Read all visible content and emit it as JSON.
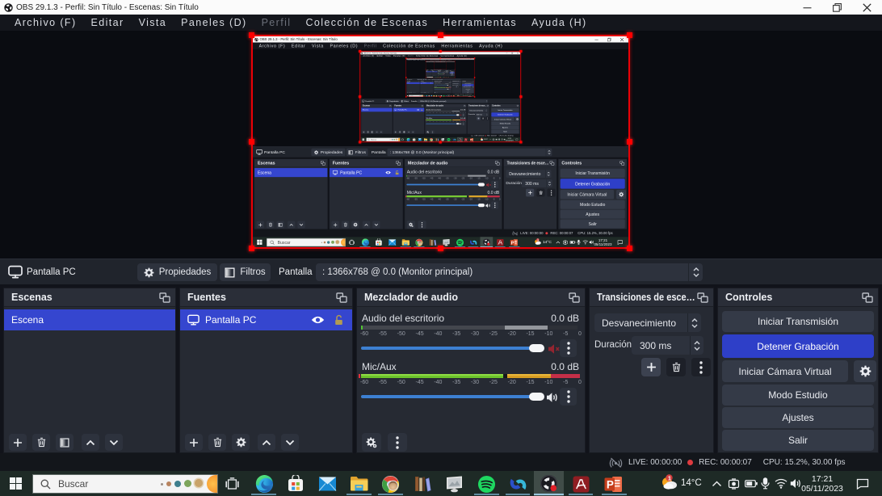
{
  "titlebar": {
    "title": "OBS 29.1.3 - Perfil: Sin Título - Escenas: Sin Título"
  },
  "menu": {
    "items": [
      {
        "label": "Archivo (F)"
      },
      {
        "label": "Editar"
      },
      {
        "label": "Vista"
      },
      {
        "label": "Paneles (D)"
      },
      {
        "label": "Perfil",
        "dimmed": true
      },
      {
        "label": "Colección de Escenas"
      },
      {
        "label": "Herramientas"
      },
      {
        "label": "Ayuda (H)"
      }
    ]
  },
  "source_toolbar": {
    "source_name": "Pantalla PC",
    "properties_label": "Propiedades",
    "filters_label": "Filtros",
    "display_label": "Pantalla",
    "display_value": ": 1366x768 @ 0.0 (Monitor principal)"
  },
  "scenes": {
    "title": "Escenas",
    "items": [
      {
        "label": "Escena",
        "selected": true
      }
    ]
  },
  "sources": {
    "title": "Fuentes",
    "items": [
      {
        "label": "Pantalla PC",
        "selected": true,
        "visible": true,
        "locked": false
      }
    ]
  },
  "mixer": {
    "title": "Mezclador de audio",
    "scale_ticks": [
      "-60",
      "-55",
      "-50",
      "-45",
      "-40",
      "-35",
      "-30",
      "-25",
      "-20",
      "-15",
      "-10",
      "-5",
      "0"
    ],
    "channels": [
      {
        "name": "Audio del escritorio",
        "level": "0.0 dB",
        "muted": true
      },
      {
        "name": "Mic/Aux",
        "level": "0.0 dB",
        "muted": false
      }
    ]
  },
  "transitions": {
    "title": "Transiciones de esce…",
    "transition_value": "Desvanecimiento",
    "duration_label": "Duración",
    "duration_value": "300 ms"
  },
  "controls": {
    "title": "Controles",
    "stream_button": "Iniciar Transmisión",
    "record_button": "Detener Grabación",
    "vcam_button": "Iniciar Cámara Virtual",
    "studio_button": "Modo Estudio",
    "settings_button": "Ajustes",
    "exit_button": "Salir"
  },
  "status_bar": {
    "live": "LIVE: 00:00:00",
    "rec": "REC: 00:00:07",
    "stats": "CPU: 15.2%, 30.00 fps"
  },
  "taskbar": {
    "search_placeholder": "Buscar",
    "pinned_apps": [
      "task-view",
      "edge",
      "microsoft-store",
      "mail",
      "file-explorer",
      "chrome",
      "calibre",
      "photo-viewer",
      "spotify",
      "uniconverter",
      "obs-studio",
      "acrobat-reader",
      "powerpoint"
    ],
    "tray": {
      "temperature": "14°C",
      "time": "17:21",
      "date": "05/11/2023",
      "weather_badge_count": "1"
    },
    "powerpoint_letter": "P"
  },
  "colors": {
    "accent_blue": "#3546cf",
    "record_button_blue": "#2e3fc8",
    "selection_red": "#ff0000",
    "meter_green": "#6cc32b",
    "meter_yellow": "#d79d22",
    "meter_red": "#c52f48",
    "slider_blue": "#3d80d2",
    "taskbar_green": "#1e2a26"
  }
}
